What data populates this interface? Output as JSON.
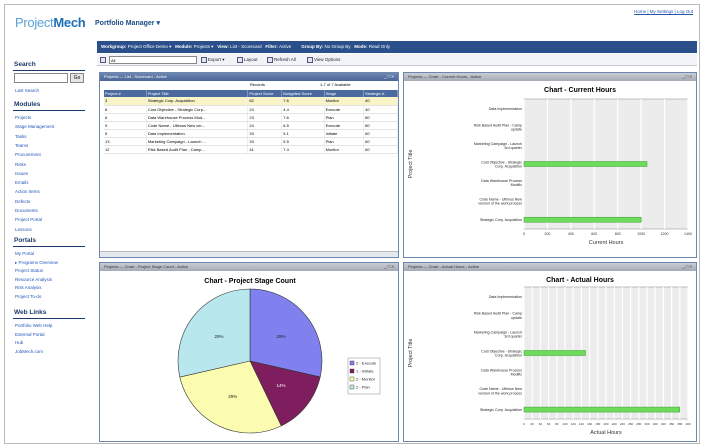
{
  "header": {
    "logo_part1": "Project",
    "logo_part2": "Mech",
    "app_title": "Portfolio Manager ▾",
    "top_links": "Home | My Settings | Log Out"
  },
  "sidebar": {
    "search_heading": "Search",
    "search_value": "",
    "go_label": "Go",
    "last_search": "Last Search",
    "modules_heading": "Modules",
    "modules": [
      "Projects",
      "Stage Management",
      "Tasks",
      "Teams",
      "Procurement",
      "Risks",
      "Issues",
      "Emails",
      "Action Items",
      "Defects",
      "Documents",
      "Project Portal",
      "Lessons"
    ],
    "portals_heading": "Portals",
    "portals": [
      "My Portal",
      "▸ Programs Overview",
      "Project Status",
      "Resource Analysis",
      "Risk Analysis",
      "Project To-do"
    ],
    "weblinks_heading": "Web Links",
    "weblinks": [
      "Portfolio Web Help",
      "External Portal",
      "Hub",
      "JobMech.com"
    ]
  },
  "filterbar": {
    "workgroup_label": "Workgroup:",
    "workgroup_value": "Project Office Demo ▾",
    "module_label": "Module:",
    "module_value": "Projects ▾",
    "view_label": "View:",
    "view_value": "List - Scorecard",
    "filter_label": "Filter:",
    "filter_value": "Active",
    "groupby_label": "Group By:",
    "groupby_value": "No Group By",
    "mode_label": "Mode:",
    "mode_value": "Read Only"
  },
  "toolbar": {
    "search_value": "All",
    "export_label": "Export ▾",
    "layout_label": "Layout",
    "refresh_label": "Refresh All",
    "options_label": "View Options"
  },
  "list_panel": {
    "title": "Projects — List - Scorecard - Active",
    "records_label": "Records",
    "records_value": "1-7 of 7 Available",
    "columns": [
      "Project #",
      "Project Title",
      "Project Score",
      "Budgeted Score",
      "Stage",
      "Strategic A"
    ],
    "rows": [
      [
        "3",
        "Strategic Corp. Acquisition",
        "82",
        "7.6",
        "Monitor",
        "40"
      ],
      [
        "8",
        "Cost Objective - Strategic Corp...",
        "24",
        "4.4",
        "Execute",
        "40"
      ],
      [
        "6",
        "Data Warehouse Process Mod...",
        "23",
        "7.6",
        "Plan",
        "80"
      ],
      [
        "9",
        "Code Name - Ultimus New ver...",
        "24",
        "6.5",
        "Execute",
        "80"
      ],
      [
        "5",
        "Data Implementation",
        "33",
        "5.1",
        "Initiate",
        "60"
      ],
      [
        "13",
        "Marketing Campaign - Launch ...",
        "33",
        "5.5",
        "Plan",
        "60"
      ],
      [
        "12",
        "Risk Based Audit Plan - Camp...",
        "41",
        "7.4",
        "Monitor",
        "60"
      ]
    ]
  },
  "current_hours_panel": {
    "title": "Projects — Chart - Current Hours - Active",
    "chart_data": {
      "type": "bar",
      "orientation": "horizontal",
      "title": "Chart - Current Hours",
      "xlabel": "Current Hours",
      "ylabel": "Project Title",
      "categories": [
        "Data Implementation",
        "Risk Based Audit Plan - Camp update",
        "Marketing Campaign - Launch 3rd quarter",
        "Cost Objective - Strategic Corp. Acquisition",
        "Data Warehouse Process Modific",
        "Code Name - Ultimus New version of the work process",
        "Strategic Corp. Acquisition"
      ],
      "values": [
        0,
        0,
        0,
        1050,
        0,
        0,
        1000
      ],
      "xlim": [
        0,
        1400
      ],
      "xticks": [
        0,
        200,
        400,
        600,
        800,
        1000,
        1200,
        1400
      ],
      "bar_color": "#6ddc5a"
    }
  },
  "stage_panel": {
    "title": "Projects — Chart - Project Stage Count - Active",
    "chart_data": {
      "type": "pie",
      "title": "Chart - Project Stage Count",
      "labels": [
        "Execute",
        "Initiate",
        "Monitor",
        "Plan"
      ],
      "values": [
        2,
        1,
        2,
        2
      ],
      "display_labels": [
        "29%",
        "14%",
        "29%",
        "29%"
      ],
      "colors": [
        "#8080ee",
        "#7e1e5e",
        "#fcfcb0",
        "#b8e8ee"
      ],
      "legend": [
        "2 - Execute",
        "1 - Initiate",
        "2 - Monitor",
        "2 - Plan"
      ]
    }
  },
  "actual_hours_panel": {
    "title": "Projects — Chart - Actual Hours - Active",
    "chart_data": {
      "type": "bar",
      "orientation": "horizontal",
      "title": "Chart - Actual Hours",
      "xlabel": "Actual Hours",
      "ylabel": "Project Title",
      "categories": [
        "Data Implementation",
        "Risk Based Audit Plan - Camp update",
        "Marketing Campaign - Launch 3rd quarter",
        "Cost Objective - Strategic Corp. Acquisition",
        "Data Warehouse Process Modific",
        "Code Name - Ultimus New version of the work process",
        "Strategic Corp. Acquisition"
      ],
      "values": [
        0,
        0,
        0,
        150,
        0,
        0,
        380
      ],
      "xlim": [
        0,
        400
      ],
      "xticks": [
        0,
        20,
        40,
        60,
        80,
        100,
        120,
        140,
        160,
        180,
        200,
        220,
        240,
        260,
        280,
        300,
        320,
        340,
        360,
        380,
        400
      ],
      "bar_color": "#6ddc5a"
    }
  }
}
